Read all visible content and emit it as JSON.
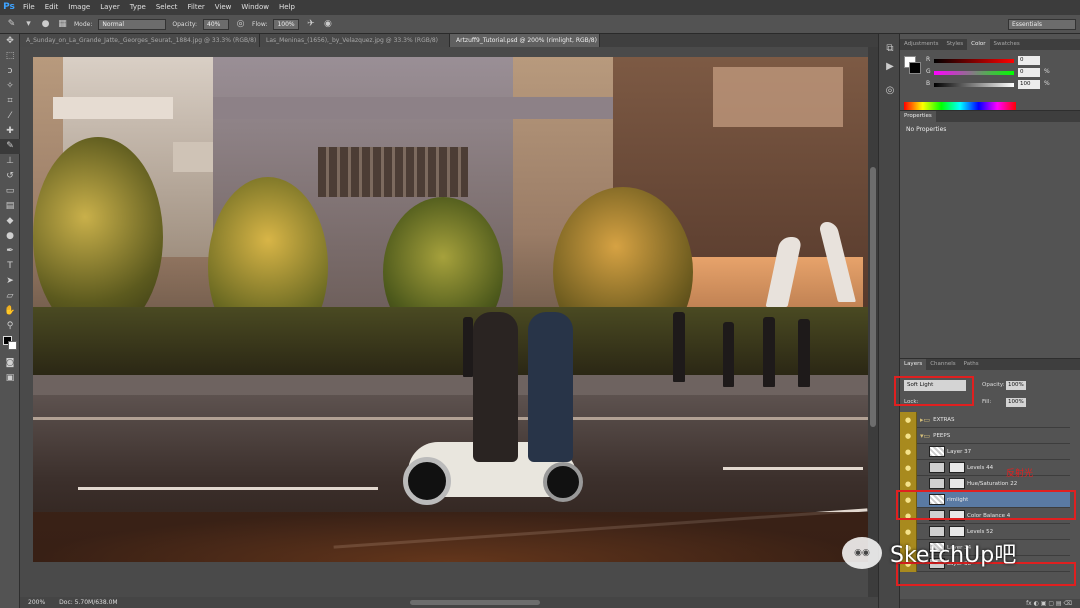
{
  "app": {
    "logo": "Ps"
  },
  "menu": [
    "File",
    "Edit",
    "Image",
    "Layer",
    "Type",
    "Select",
    "Filter",
    "View",
    "Window",
    "Help"
  ],
  "options_bar": {
    "mode_label": "Mode:",
    "mode_value": "Normal",
    "opacity_label": "Opacity:",
    "opacity_value": "40%",
    "flow_label": "Flow:",
    "flow_value": "100%",
    "workspace": "Essentials"
  },
  "document_tabs": [
    {
      "label": "A_Sunday_on_La_Grande_Jatte,_Georges_Seurat,_1884.jpg @ 33.3% (RGB/8)"
    },
    {
      "label": "Las_Meninas_(1656),_by_Velazquez.jpg @ 33.3% (RGB/8)"
    },
    {
      "label": "Artzuff9_Tutorial.psd @ 200% (rimlight, RGB/8) *"
    }
  ],
  "status_bar": {
    "zoom": "200%",
    "doc_info": "Doc: 5.70M/638.0M"
  },
  "color_panel": {
    "tabs": [
      "Adjustments",
      "Styles",
      "Color",
      "Swatches"
    ],
    "active_tab": "Color",
    "r_label": "R",
    "r_value": "0",
    "g_label": "G",
    "g_value": "0",
    "b_label": "B",
    "b_value": "100",
    "pct": "%"
  },
  "properties_panel": {
    "title": "Properties",
    "body": "No Properties"
  },
  "layers_panel": {
    "tabs": [
      "Layers",
      "Channels",
      "Paths"
    ],
    "blend_mode": "Soft Light",
    "opacity_label": "Opacity:",
    "opacity_value": "100%",
    "lock_label": "Lock:",
    "fill_label": "Fill:",
    "fill_value": "100%",
    "layers": [
      {
        "name": "EXTRAS"
      },
      {
        "name": "PEEPS"
      },
      {
        "name": "Layer 37"
      },
      {
        "name": "Levels 44"
      },
      {
        "name": "Hue/Saturation 22"
      },
      {
        "name": "rimlight"
      },
      {
        "name": "Color Balance 4"
      },
      {
        "name": "Levels 52"
      },
      {
        "name": "Layer 34"
      },
      {
        "name": "Layer 38"
      }
    ],
    "footer_icons": "fx ◐ ▣ ▢ ▤ ⌫"
  },
  "annotation": {
    "label": "反射光"
  },
  "watermark": {
    "text": "SketchUp吧"
  },
  "colors": {
    "accent_red": "#e02020",
    "selected_layer": "#5a7aa3",
    "ps_blue": "#3ea3ff"
  }
}
